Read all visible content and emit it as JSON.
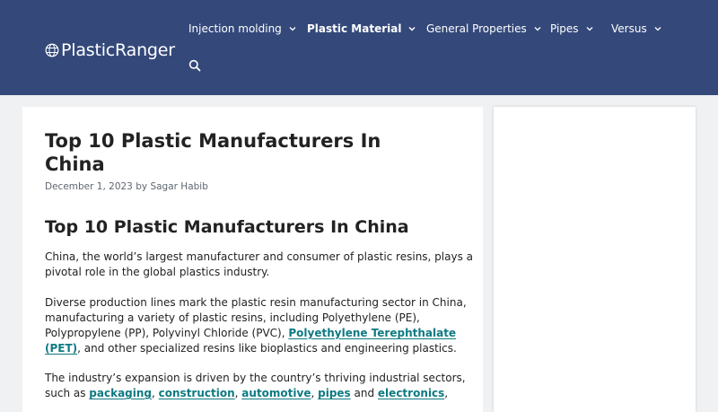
{
  "header": {
    "logo_text": "PlasticRanger",
    "nav": [
      {
        "label": "Injection molding"
      },
      {
        "label": "Plastic Material"
      },
      {
        "label": "General Properties"
      },
      {
        "label": "Pipes"
      },
      {
        "label": "Versus"
      }
    ]
  },
  "article": {
    "title_line1": "Top 10 Plastic Manufacturers In",
    "title_line2": "China",
    "date": "December 1, 2023",
    "by": "by",
    "author": "Sagar Habib",
    "heading": "Top 10 Plastic Manufacturers In China",
    "p1": {
      "line1": "China, the world’s largest manufacturer and consumer of plastic resins, plays a",
      "line2": "pivotal role in the global plastics industry."
    },
    "p2": {
      "line1": "Diverse production lines mark the plastic resin manufacturing sector in China,",
      "line2": "manufacturing a variety of plastic resins, including Polyethylene (PE),",
      "line3": "Polypropylene (PP), Polyvinyl Chloride (PVC), ",
      "link1": "Polyethylene Terephthalate",
      "link2": "(PET)",
      "line4_rest": ", and other specialized resins like bioplastics and engineering plastics."
    },
    "p3": {
      "line1": "The industry’s expansion is driven by the country’s thriving industrial sectors,",
      "line2_start": "such as ",
      "links": [
        "packaging",
        "construction",
        "automotive",
        "pipes",
        "electronics"
      ],
      "sep1": ", ",
      "sep2": ", ",
      "sep3": ", ",
      "and": " and ",
      "end": ","
    }
  },
  "colors": {
    "header_bg": "#34497a",
    "page_bg": "#f0f1f3",
    "link": "#0e7a82"
  },
  "icons": {
    "logo": "globe-icon",
    "nav_dropdown": "chevron-down-icon",
    "search": "search-icon"
  }
}
